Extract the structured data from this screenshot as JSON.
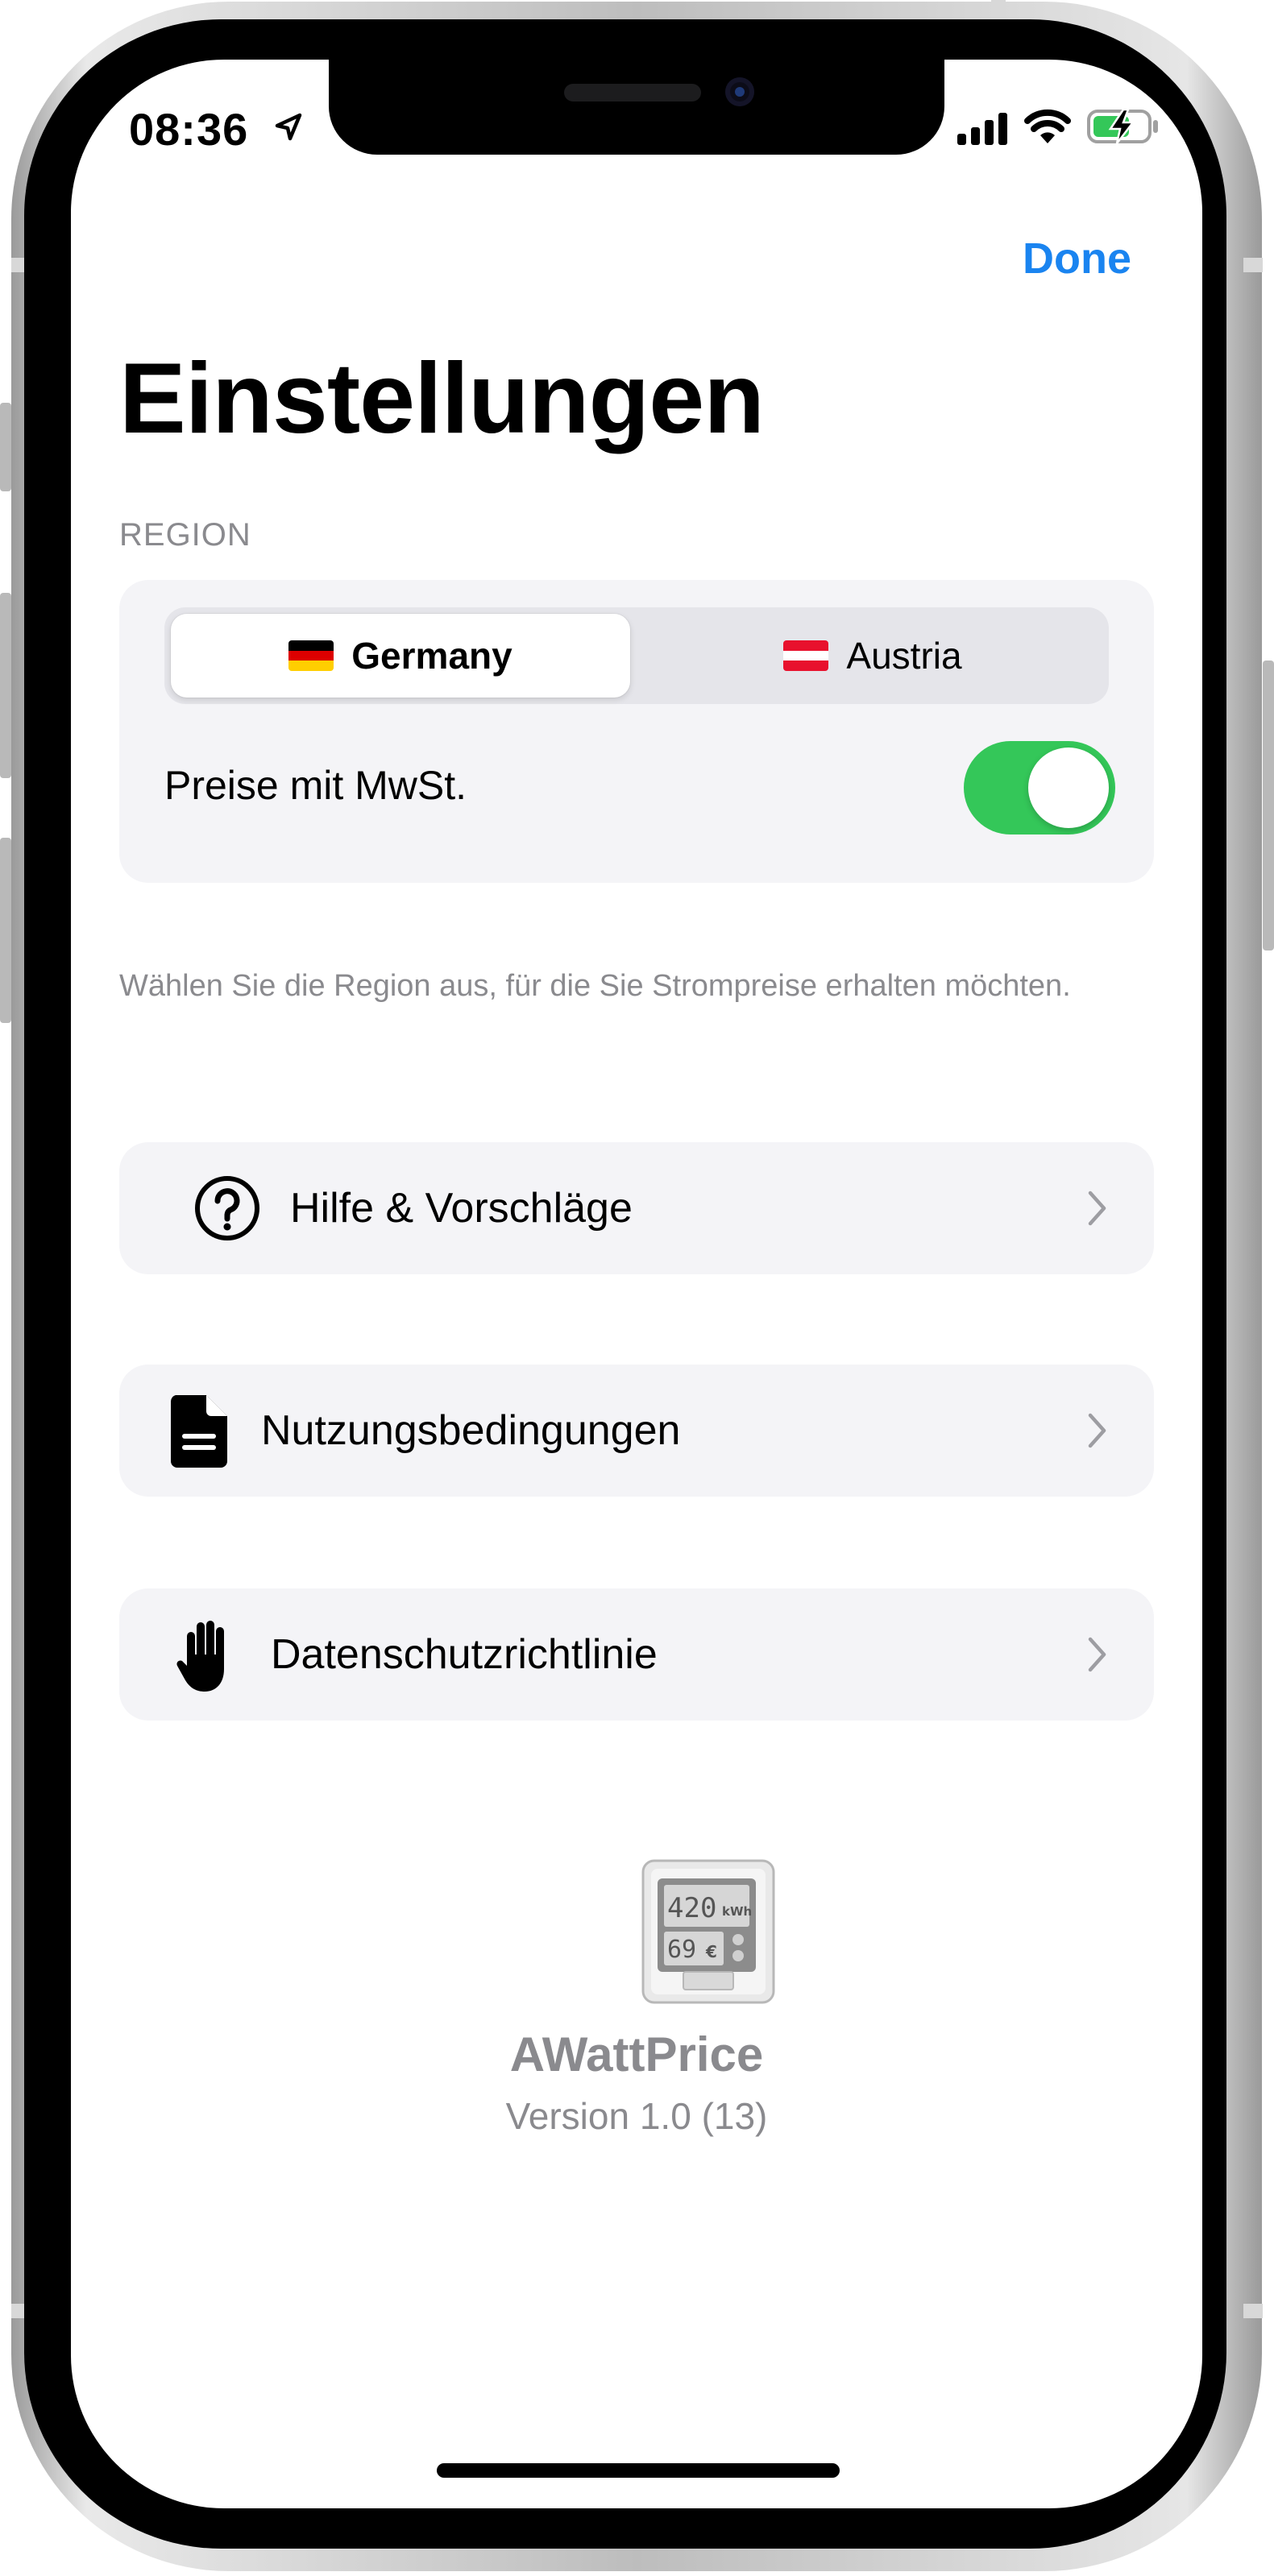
{
  "status_bar": {
    "time": "08:36",
    "icons": [
      "location-arrow-icon",
      "cellular-signal-icon",
      "wifi-icon",
      "battery-charging-icon"
    ]
  },
  "nav": {
    "done_label": "Done",
    "title": "Einstellungen"
  },
  "region": {
    "header": "REGION",
    "segments": [
      {
        "label": "Germany",
        "flag": "germany-flag-icon",
        "selected": true
      },
      {
        "label": "Austria",
        "flag": "austria-flag-icon",
        "selected": false
      }
    ],
    "vat_label": "Preise mit MwSt.",
    "vat_enabled": true,
    "footer": "Wählen Sie die Region aus, für die Sie Strompreise erhalten möchten."
  },
  "rows": [
    {
      "label": "Hilfe & Vorschläge",
      "icon": "question-circle-icon"
    },
    {
      "label": "Nutzungsbedingungen",
      "icon": "document-icon"
    },
    {
      "label": "Datenschutzrichtlinie",
      "icon": "hand-raised-icon"
    }
  ],
  "about": {
    "app_name": "AWattPrice",
    "version": "Version 1.0 (13)",
    "icon_display": {
      "top": "420",
      "top_unit": "kWh",
      "bottom": "69",
      "bottom_unit": "€"
    }
  },
  "colors": {
    "accent": "#1a84f0",
    "toggle_on": "#34c759",
    "card_background": "#f4f4f7",
    "secondary_text": "#8a8a8e"
  }
}
